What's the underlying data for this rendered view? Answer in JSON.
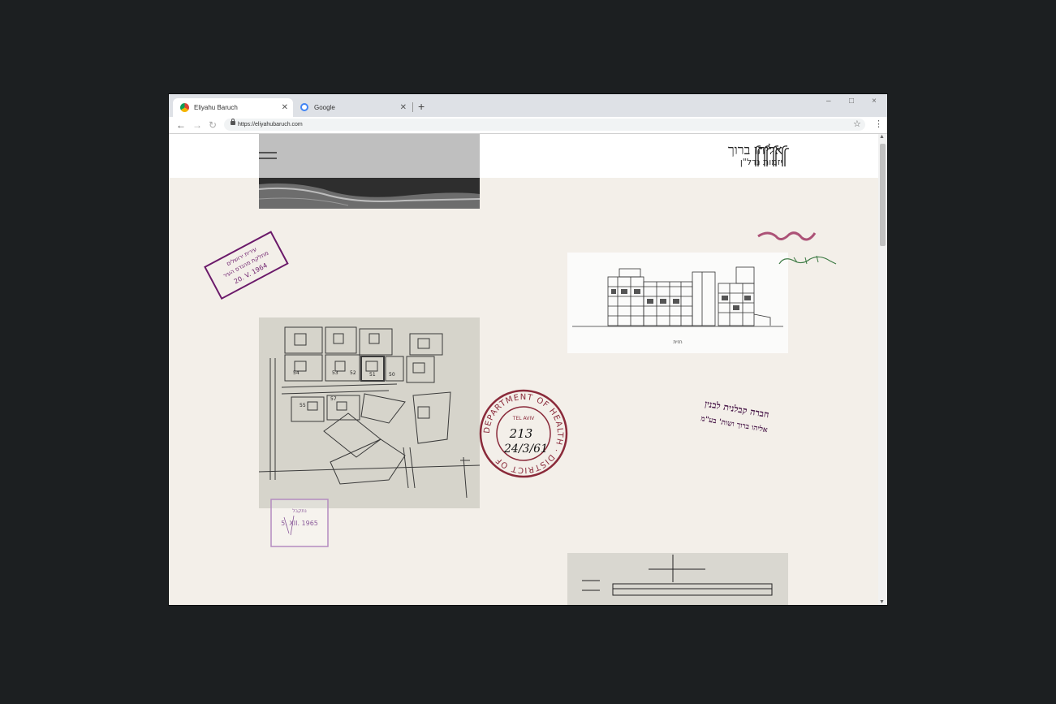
{
  "browser": {
    "tabs": [
      {
        "label": "Eliyahu Baruch",
        "active": true,
        "favicon": "chrome-icon"
      },
      {
        "label": "Google",
        "active": false,
        "favicon": "google-icon"
      }
    ],
    "new_tab": "+",
    "url": "https://eliyahubaruch.com",
    "window_controls": {
      "minimize": "–",
      "maximize": "□",
      "close": "×"
    }
  },
  "site": {
    "logo_title": "אליהו ברוך",
    "logo_subtitle": "יזמות נדל\"ן",
    "stamps": {
      "stamp_1": [
        "עירית ירושלים",
        "מחלקת מהנדס העיר",
        "20. V. 1964"
      ],
      "stamp_2": [
        "נתקבל",
        "5. XII. 1965"
      ],
      "health_stamp_ring": "DEPARTMENT OF HEALTH · DISTRICT OF",
      "health_stamp_center": "TEL AVIV",
      "health_stamp_written": [
        "213",
        "24/3/61"
      ],
      "company_stamp": [
        "חברה קבלנית לבנין",
        "אליהו ברוך ושות' בע\"מ"
      ]
    },
    "drawing_caption": "חזית",
    "siteplan_labels": [
      "54",
      "53",
      "52",
      "51",
      "50",
      "55",
      "57"
    ]
  },
  "colors": {
    "page_bg": "#f3efe9",
    "stamp_purple": "#6b1a6a",
    "stamp_red": "#8a2a3a",
    "ink_green": "#3d7a44"
  }
}
